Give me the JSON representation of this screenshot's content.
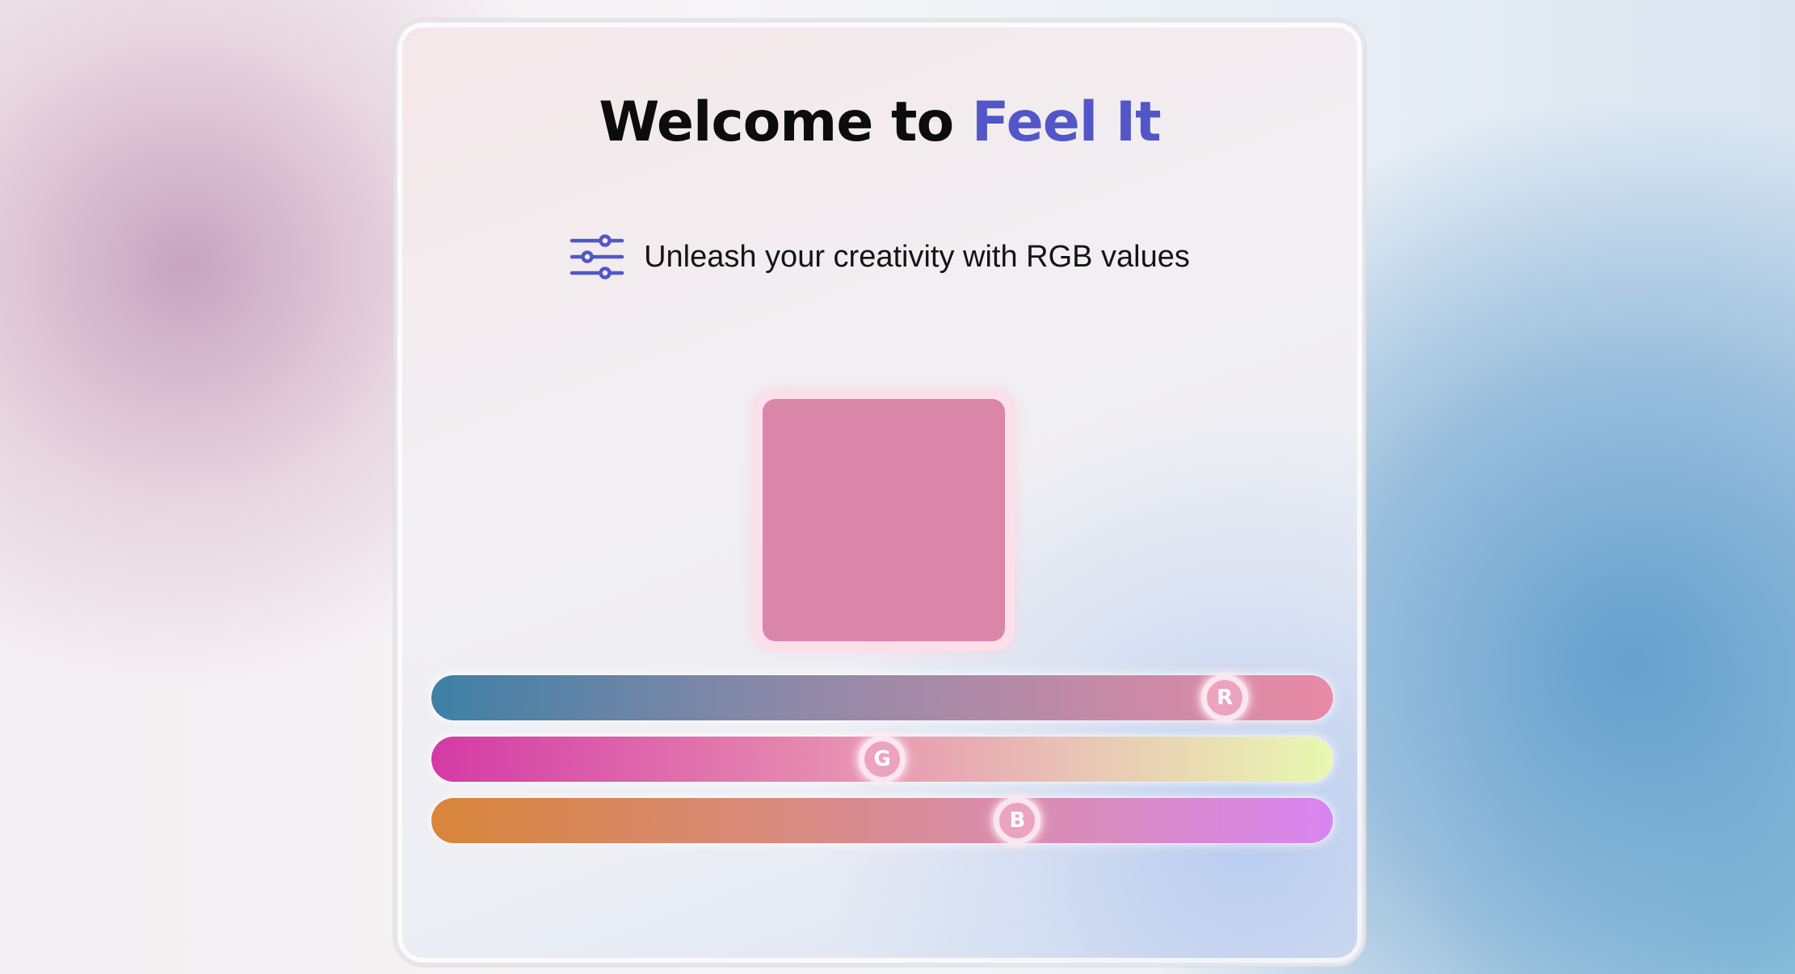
{
  "header": {
    "title_prefix": "Welcome to ",
    "title_brand": "Feel It",
    "brand_color": "#5356c8"
  },
  "tagline": {
    "icon": "sliders-icon",
    "text": "Unleash your creativity with RGB values"
  },
  "preview": {
    "color": "#d986a9"
  },
  "sliders": [
    {
      "channel": "R",
      "label": "R",
      "value_fraction": 0.88
    },
    {
      "channel": "G",
      "label": "G",
      "value_fraction": 0.5
    },
    {
      "channel": "B",
      "label": "B",
      "value_fraction": 0.65
    }
  ]
}
